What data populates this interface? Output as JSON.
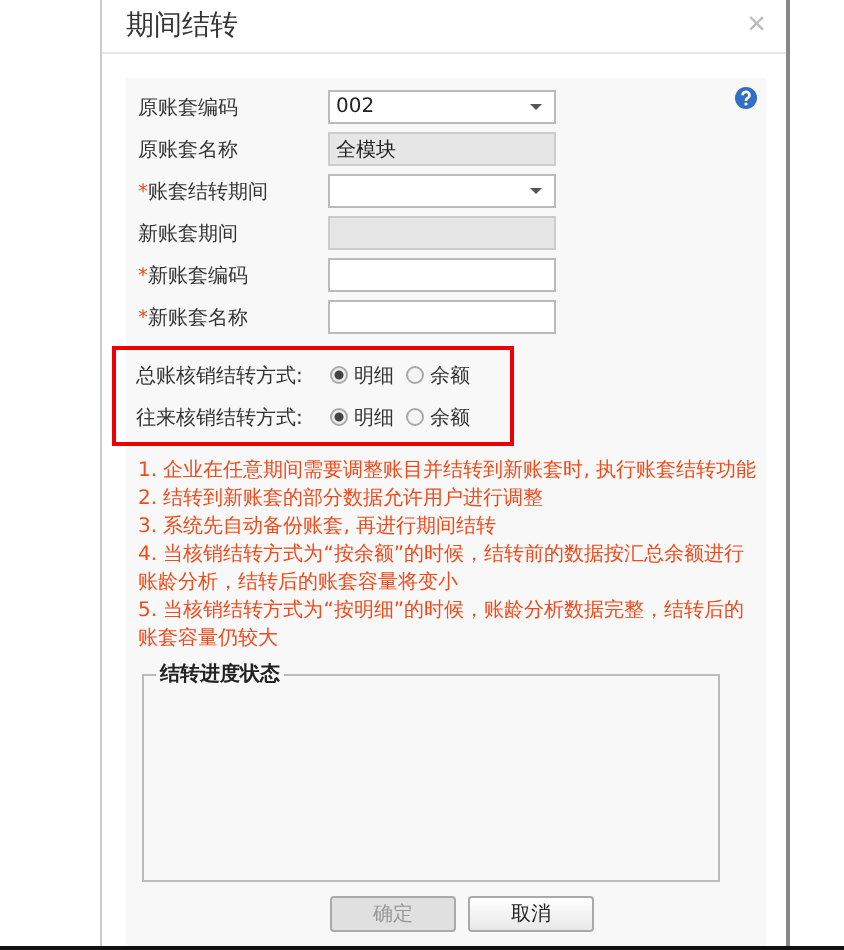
{
  "window": {
    "title": "期间结转",
    "close": "×"
  },
  "fields": [
    {
      "label": "原账套编码",
      "kind": "select",
      "readonly": false,
      "value": "002"
    },
    {
      "label": "原账套名称",
      "kind": "text",
      "readonly": true,
      "value": "全模块"
    },
    {
      "label": "账套结转期间",
      "marker": "*",
      "kind": "select",
      "readonly": false
    },
    {
      "label": "新账套期间",
      "kind": "text",
      "readonly": true
    },
    {
      "label": "新账套编码",
      "marker": "*",
      "kind": "text",
      "readonly": false
    },
    {
      "label": "新账套名称",
      "marker": "*",
      "kind": "text",
      "readonly": false
    }
  ],
  "options": [
    {
      "label": "总账核销结转方式:",
      "choices": [
        {
          "label": "明细",
          "selected": true
        },
        {
          "label": "余额",
          "selected": false
        }
      ]
    },
    {
      "label": "往来核销结转方式:",
      "choices": [
        {
          "label": "明细",
          "selected": true
        },
        {
          "label": "余额",
          "selected": false
        }
      ]
    }
  ],
  "notes": [
    "1. 企业在任意期间需要调整账目并结转到新账套时, 执行账套结转功能",
    "2. 结转到新账套的部分数据允许用户进行调整",
    "3. 系统先自动备份账套, 再进行期间结转",
    "4. 当核销结转方式为“按余额”的时候，结转前的数据按汇总余额进行账龄分析，结转后的账套容量将变小",
    "5. 当核销结转方式为“按明细”的时候，账龄分析数据完整，结转后的账套容量仍较大"
  ],
  "progress": {
    "title": "结转进度状态"
  },
  "buttons": [
    {
      "label": "确定",
      "disabled": true
    },
    {
      "label": "取消",
      "disabled": false
    }
  ]
}
